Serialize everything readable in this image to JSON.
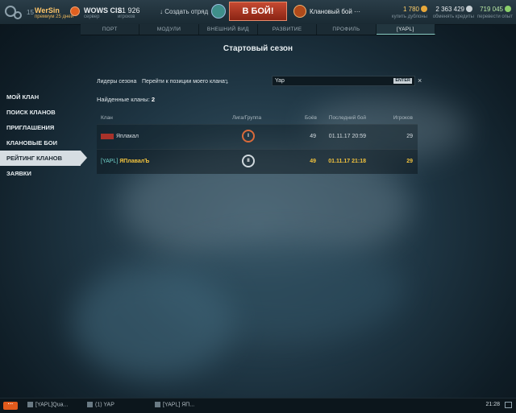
{
  "header": {
    "level": "15",
    "username": "WerSin",
    "premium_text": "премиум 25 дней",
    "server_name": "WOWS CIS",
    "server_sub": "сервер",
    "online_count": "21 926",
    "online_sub": "игроков",
    "create_squad": "Создать отряд",
    "battle_button": "В БОЙ!",
    "clan_battle": "Клановый бой ···",
    "doubloons": "1 780",
    "doubloons_sub": "купить дублоны",
    "credits": "2 363 429",
    "credits_sub": "обменять кредиты",
    "free_xp": "719 045",
    "free_xp_sub": "перевести опыт"
  },
  "tabs": [
    {
      "label": "ПОРТ",
      "active": false
    },
    {
      "label": "МОДУЛИ",
      "active": false
    },
    {
      "label": "ВНЕШНИЙ ВИД",
      "active": false
    },
    {
      "label": "РАЗВИТИЕ",
      "active": false
    },
    {
      "label": "ПРОФИЛЬ",
      "active": false
    },
    {
      "label": "[YAPL]",
      "active": true
    }
  ],
  "season_title": "Стартовый сезон",
  "sidebar": {
    "items": [
      {
        "label": "МОЙ КЛАН",
        "active": false
      },
      {
        "label": "ПОИСК КЛАНОВ",
        "active": false
      },
      {
        "label": "ПРИГЛАШЕНИЯ",
        "active": false
      },
      {
        "label": "КЛАНОВЫЕ БОИ",
        "active": false
      },
      {
        "label": "РЕЙТИНГ КЛАНОВ",
        "active": true
      },
      {
        "label": "ЗАЯВКИ",
        "active": false
      }
    ]
  },
  "links": {
    "season_leaders": "Лидеры сезона",
    "goto_my_clan": "Перейти к позиции моего клана"
  },
  "search": {
    "value": "Yap",
    "enter_label": "ENTER",
    "clear": "×"
  },
  "found": {
    "label": "Найденные кланы:",
    "count": "2"
  },
  "table": {
    "headers": {
      "clan": "Клан",
      "league": "Лига/Группа",
      "battles": "Боёв",
      "last_battle": "Последний бой",
      "players": "Игроков"
    },
    "rows": [
      {
        "tag": "",
        "name": "Яплакал",
        "league": "I",
        "battles": "49",
        "last_battle": "01.11.17 20:59",
        "players": "29",
        "mine": false
      },
      {
        "tag": "[YAPL]",
        "name": "ЯПлавалЪ",
        "league": "II",
        "battles": "49",
        "last_battle": "01.11.17 21:18",
        "players": "29",
        "mine": true
      }
    ]
  },
  "bottombar": {
    "chat_button": "···",
    "item1": "[YAPL]Qua...",
    "item2": "(1) YAP",
    "item3": "[YAPL] ЯП...",
    "clock": "21:28"
  },
  "colors": {
    "accent_yellow": "#f1c23e",
    "battle_button": "#c64a32",
    "league_one": "#d96a3a"
  }
}
